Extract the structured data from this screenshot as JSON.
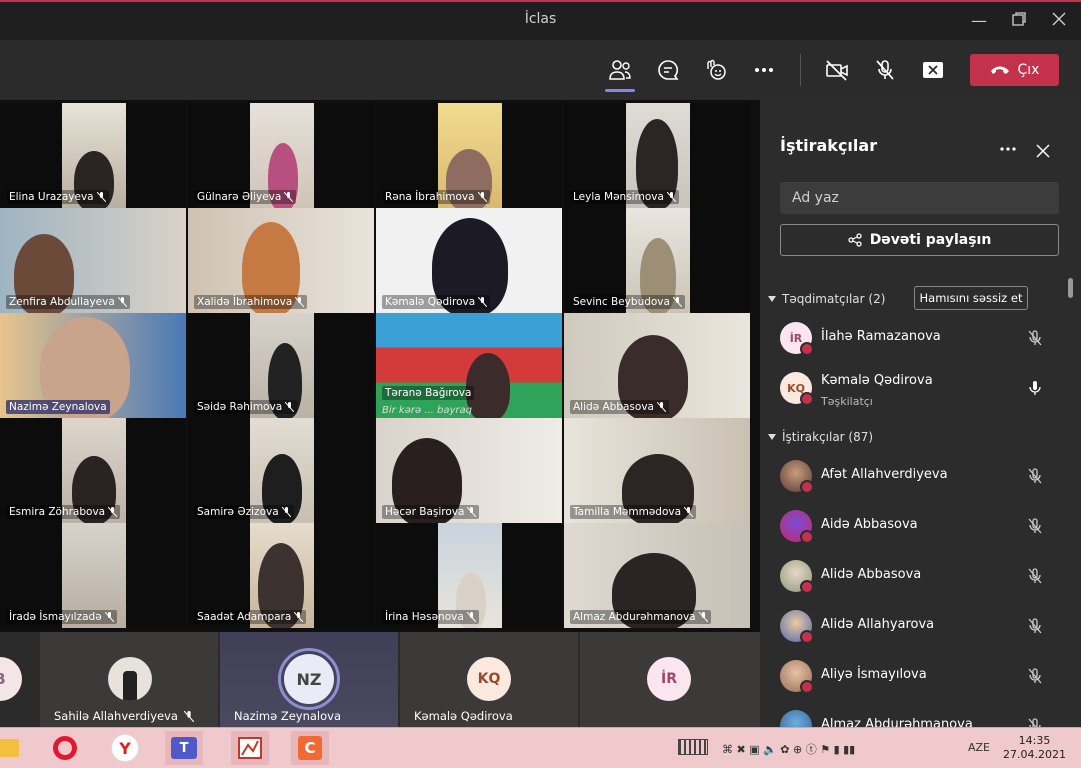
{
  "window": {
    "title": "İclas"
  },
  "toolbar": {
    "leave_label": "Çıx"
  },
  "video_grid": [
    {
      "name": "Elina Urazayeva"
    },
    {
      "name": "Gülnarə Əliyeva"
    },
    {
      "name": "Rəna İbrahimova"
    },
    {
      "name": "Leyla Mənsimova"
    },
    {
      "name": "Zenfira Abdullayeva"
    },
    {
      "name": "Xalidə İbrahimova"
    },
    {
      "name": "Kəmalə Qədirova"
    },
    {
      "name": "Sevinc Beybudova"
    },
    {
      "name": "Nazimə Zeynalova"
    },
    {
      "name": "Səidə Rəhimova"
    },
    {
      "name": "Təranə Bağırova"
    },
    {
      "name": "Alidə Abbasova"
    },
    {
      "name": "Esmira Zöhrabova"
    },
    {
      "name": "Samirə Əzizova"
    },
    {
      "name": "Həcər Başirova"
    },
    {
      "name": "Tamilla Məmmədova"
    },
    {
      "name": "İradə İsmayılzadə"
    },
    {
      "name": "Saadət Adampara"
    },
    {
      "name": "İrina Həsənova"
    },
    {
      "name": "Almaz Abdurəhmanova"
    }
  ],
  "flag_caption": "Bir kərə ... bayraq",
  "bottom_strip": [
    {
      "initials": "B",
      "name": ""
    },
    {
      "initials": "",
      "name": "Sahilə Allahverdiyeva"
    },
    {
      "initials": "NZ",
      "name": "Nazimə Zeynalova"
    },
    {
      "initials": "KQ",
      "name": "Kəmalə Qədirova"
    },
    {
      "initials": "İR",
      "name": ""
    }
  ],
  "panel": {
    "title": "İştirakçılar",
    "search_placeholder": "Ad yaz",
    "share_label": "Dəvəti paylaşın",
    "presenters_header": "Təqdimatçılar (2)",
    "mute_all_label": "Hamısını səssiz et",
    "presenters": [
      {
        "initials": "İR",
        "name": "İlahə Ramazanova",
        "role": ""
      },
      {
        "initials": "KQ",
        "name": "Kəmalə Qədirova",
        "role": "Təşkilatçı"
      }
    ],
    "attendees_header": "İştirakçılar (87)",
    "attendees": [
      {
        "name": "Afət Allahverdiyeva"
      },
      {
        "name": "Aidə Abbasova"
      },
      {
        "name": "Alidə Abbasova"
      },
      {
        "name": "Alidə Allahyarova"
      },
      {
        "name": "Aliyə İsmayılova"
      },
      {
        "name": "Almaz Abdurəhmanova"
      }
    ]
  },
  "taskbar": {
    "lang": "AZE",
    "time": "14:35",
    "date": "27.04.2021"
  }
}
